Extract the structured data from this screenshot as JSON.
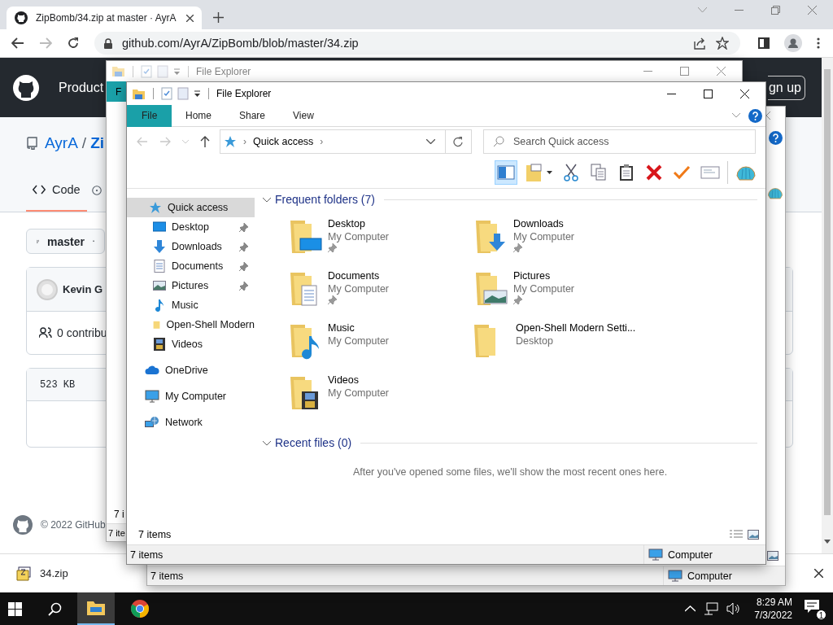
{
  "browser": {
    "tab": {
      "title": "ZipBomb/34.zip at master · AyrA",
      "selected": true
    },
    "url": "github.com/AyrA/ZipBomb/blob/master/34.zip"
  },
  "github": {
    "nav_item": "Product",
    "signup": "gn up",
    "owner": "AyrA",
    "separator": "/",
    "repo": "Zi",
    "code_tab": "Code",
    "branch": "master",
    "author": "Kevin G",
    "contributors": "0 contribu",
    "size": "523 KB",
    "footer": "© 2022 GitHub"
  },
  "downloads": [
    {
      "name": "34.zip"
    }
  ],
  "explorer_behind_top": {
    "title": "File Explorer",
    "tab": "F",
    "item_count": "7 i",
    "status": "7 ite"
  },
  "explorer_behind_bottom": {
    "status_items": "7 items",
    "status_location": "Computer"
  },
  "explorer": {
    "title": "File Explorer",
    "ribbon_tabs": [
      {
        "label": "File",
        "selected": true
      },
      {
        "label": "Home",
        "selected": false
      },
      {
        "label": "Share",
        "selected": false
      },
      {
        "label": "View",
        "selected": false
      }
    ],
    "address": [
      {
        "kind": "separator",
        "text": "›"
      },
      {
        "kind": "location",
        "text": "Quick access"
      },
      {
        "kind": "separator",
        "text": "›"
      }
    ],
    "search": {
      "placeholder": "Search Quick access"
    },
    "toolbar": [
      {
        "kind": "pane",
        "selected": true
      },
      {
        "kind": "folder-options",
        "selected": false
      },
      {
        "kind": "cut",
        "selected": false
      },
      {
        "kind": "copy",
        "selected": false
      },
      {
        "kind": "paste",
        "selected": false
      },
      {
        "kind": "delete",
        "selected": false
      },
      {
        "kind": "properties",
        "selected": false
      },
      {
        "kind": "email",
        "selected": false
      },
      {
        "kind": "shell",
        "selected": false
      }
    ],
    "nav_pane": [
      {
        "label": "Quick access",
        "kind": "quick",
        "selected": true,
        "children": [
          {
            "label": "Desktop",
            "kind": "desktop",
            "pinned": true,
            "selected": false
          },
          {
            "label": "Downloads",
            "kind": "downloads",
            "pinned": true,
            "selected": false
          },
          {
            "label": "Documents",
            "kind": "documents",
            "pinned": true,
            "selected": false
          },
          {
            "label": "Pictures",
            "kind": "pictures",
            "pinned": true,
            "selected": false
          },
          {
            "label": "Music",
            "kind": "music",
            "pinned": false,
            "selected": false
          },
          {
            "label": "Open-Shell Modern",
            "kind": "plain",
            "pinned": false,
            "selected": false
          },
          {
            "label": "Videos",
            "kind": "videos",
            "pinned": false,
            "selected": false
          }
        ]
      },
      {
        "label": "OneDrive",
        "kind": "onedrive",
        "selected": false
      },
      {
        "label": "My Computer",
        "kind": "computer",
        "selected": false
      },
      {
        "label": "Network",
        "kind": "network",
        "selected": false
      }
    ],
    "sections": [
      {
        "title": "Frequent folders (7)",
        "expanded": true,
        "folders": [
          {
            "name": "Desktop",
            "location": "My Computer",
            "pinned": true,
            "kind": "desktop"
          },
          {
            "name": "Downloads",
            "location": "My Computer",
            "pinned": true,
            "kind": "downloads"
          },
          {
            "name": "Documents",
            "location": "My Computer",
            "pinned": true,
            "kind": "documents"
          },
          {
            "name": "Pictures",
            "location": "My Computer",
            "pinned": true,
            "kind": "pictures"
          },
          {
            "name": "Music",
            "location": "My Computer",
            "pinned": false,
            "kind": "music"
          },
          {
            "name": "Open-Shell Modern Setti...",
            "location": "Desktop",
            "pinned": false,
            "kind": "plain"
          },
          {
            "name": "Videos",
            "location": "My Computer",
            "pinned": false,
            "kind": "videos"
          }
        ]
      },
      {
        "title": "Recent files (0)",
        "expanded": true,
        "message": "After you've opened some files, we'll show the most recent ones here."
      }
    ],
    "item_count": "7 items",
    "status": {
      "items": "7 items",
      "location": "Computer"
    }
  },
  "taskbar": {
    "apps": [
      {
        "kind": "explorer",
        "selected": true
      },
      {
        "kind": "chrome",
        "selected": false
      }
    ],
    "time": "8:29 AM",
    "date": "7/3/2022",
    "notifications": "1"
  }
}
